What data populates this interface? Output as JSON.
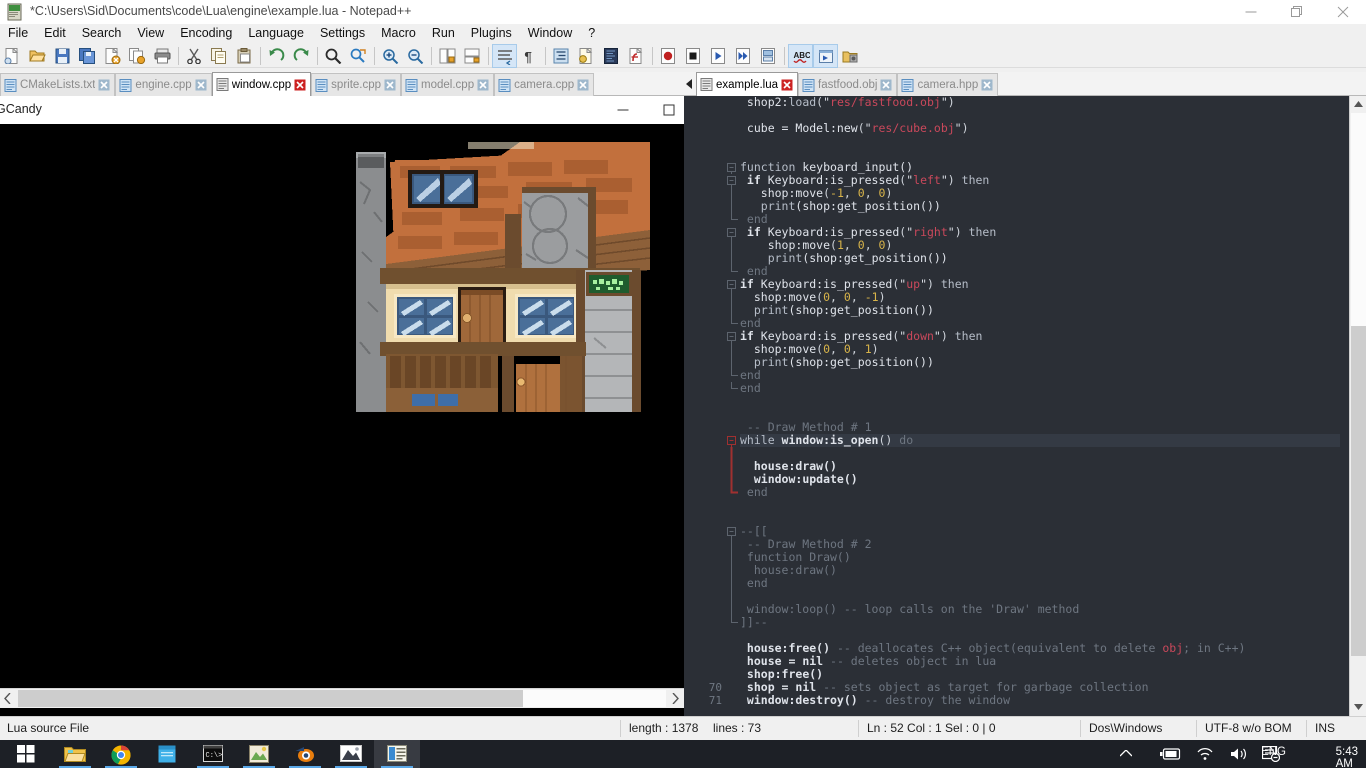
{
  "npp": {
    "title": "*C:\\Users\\Sid\\Documents\\code\\Lua\\engine\\example.lua - Notepad++",
    "app_icon": "notepadpp-icon",
    "window_controls": {
      "minimize": "minimize-icon",
      "maximize": "maximize-icon",
      "close": "close-icon"
    },
    "menu": [
      "File",
      "Edit",
      "Search",
      "View",
      "Encoding",
      "Language",
      "Settings",
      "Macro",
      "Run",
      "Plugins",
      "Window",
      "?"
    ],
    "toolbar": [
      {
        "name": "new-file",
        "sep": false
      },
      {
        "name": "open-file",
        "sep": false
      },
      {
        "name": "save-file",
        "sep": false
      },
      {
        "name": "save-all",
        "sep": false
      },
      {
        "name": "close-file",
        "sep": false
      },
      {
        "name": "close-all",
        "sep": false
      },
      {
        "name": "print",
        "sep": true
      },
      {
        "name": "cut",
        "sep": false
      },
      {
        "name": "copy",
        "sep": false
      },
      {
        "name": "paste",
        "sep": true
      },
      {
        "name": "undo",
        "sep": false
      },
      {
        "name": "redo",
        "sep": true
      },
      {
        "name": "find",
        "sep": false
      },
      {
        "name": "replace",
        "sep": true
      },
      {
        "name": "zoom-in",
        "sep": false
      },
      {
        "name": "zoom-out",
        "sep": true
      },
      {
        "name": "sync-vertical-scroll",
        "sep": false
      },
      {
        "name": "sync-horizontal-scroll",
        "sep": true
      },
      {
        "name": "word-wrap",
        "sep": false
      },
      {
        "name": "show-all-characters",
        "sep": true
      },
      {
        "name": "indent-guide",
        "sep": false
      },
      {
        "name": "user-defined-dialog",
        "sep": false
      },
      {
        "name": "document-map",
        "sep": false
      },
      {
        "name": "function-list",
        "sep": true
      },
      {
        "name": "start-record-macro",
        "sep": false
      },
      {
        "name": "stop-record-macro",
        "sep": false
      },
      {
        "name": "play-macro",
        "sep": false
      },
      {
        "name": "run-macro-multiple",
        "sep": false
      },
      {
        "name": "save-macro",
        "sep": true
      },
      {
        "name": "spell-check",
        "sep": false
      },
      {
        "name": "run",
        "sep": false
      },
      {
        "name": "open-folder-explorer",
        "sep": false
      }
    ],
    "tabs_left": [
      {
        "label": "CMakeLists.txt",
        "active": false
      },
      {
        "label": "engine.cpp",
        "active": false
      },
      {
        "label": "window.cpp",
        "active": true
      },
      {
        "label": "sprite.cpp",
        "active": false
      },
      {
        "label": "model.cpp",
        "active": false
      },
      {
        "label": "camera.cpp",
        "active": false
      }
    ],
    "tabs_right": [
      {
        "label": "example.lua",
        "active": true
      },
      {
        "label": "fastfood.obj",
        "active": false
      },
      {
        "label": "camera.hpp",
        "active": false
      }
    ],
    "status": {
      "doc_type": "Lua source File",
      "length_label": "length : 1378",
      "lines_label": "lines : 73",
      "caret": "Ln : 52   Col : 1   Sel : 0 | 0",
      "eol": "Dos\\Windows",
      "encoding": "UTF-8 w/o BOM",
      "insert_mode": "INS"
    },
    "gutter_line_numbers": [
      "70",
      "71"
    ]
  },
  "editor": {
    "first_visible_line": 18,
    "code_lines": [
      {
        "fold": "",
        "cur": false,
        "tokens": [
          {
            "t": " shop2:",
            "c": "id"
          },
          {
            "t": "load",
            "c": "fn"
          },
          {
            "t": "(",
            "c": "pn"
          },
          {
            "t": "\"",
            "c": "strq"
          },
          {
            "t": "res/fastfood.obj",
            "c": "str"
          },
          {
            "t": "\"",
            "c": "strq"
          },
          {
            "t": ")",
            "c": "pn"
          }
        ]
      },
      {
        "fold": "",
        "cur": false,
        "tokens": []
      },
      {
        "fold": "",
        "cur": false,
        "tokens": [
          {
            "t": " cube = ",
            "c": "id"
          },
          {
            "t": "Model:new",
            "c": "id"
          },
          {
            "t": "(",
            "c": "pn"
          },
          {
            "t": "\"",
            "c": "strq"
          },
          {
            "t": "res/cube.obj",
            "c": "str"
          },
          {
            "t": "\"",
            "c": "strq"
          },
          {
            "t": ")",
            "c": "pn"
          }
        ]
      },
      {
        "fold": "",
        "cur": false,
        "tokens": []
      },
      {
        "fold": "",
        "cur": false,
        "tokens": []
      },
      {
        "fold": "open",
        "cur": false,
        "tokens": [
          {
            "t": "function ",
            "c": "kw2"
          },
          {
            "t": "keyboard_input()",
            "c": "id"
          }
        ]
      },
      {
        "fold": "open",
        "cur": false,
        "tokens": [
          {
            "t": " if ",
            "c": "kw"
          },
          {
            "t": "Keyboard:is_pressed",
            "c": "id"
          },
          {
            "t": "(",
            "c": "pn"
          },
          {
            "t": "\"",
            "c": "strq"
          },
          {
            "t": "left",
            "c": "str"
          },
          {
            "t": "\"",
            "c": "strq"
          },
          {
            "t": ") ",
            "c": "pn"
          },
          {
            "t": "then",
            "c": "kw2"
          }
        ]
      },
      {
        "fold": "bar",
        "cur": false,
        "tokens": [
          {
            "t": "   shop:",
            "c": "id"
          },
          {
            "t": "move",
            "c": "id"
          },
          {
            "t": "(",
            "c": "pn"
          },
          {
            "t": "-1",
            "c": "num"
          },
          {
            "t": ", ",
            "c": "pn"
          },
          {
            "t": "0",
            "c": "num"
          },
          {
            "t": ", ",
            "c": "pn"
          },
          {
            "t": "0",
            "c": "num"
          },
          {
            "t": ")",
            "c": "pn"
          }
        ]
      },
      {
        "fold": "bar",
        "cur": false,
        "tokens": [
          {
            "t": "   ",
            "c": "id"
          },
          {
            "t": "print",
            "c": "fn"
          },
          {
            "t": "(shop:get_position())",
            "c": "id"
          }
        ]
      },
      {
        "fold": "end",
        "cur": false,
        "tokens": [
          {
            "t": " end",
            "c": "cmt"
          }
        ]
      },
      {
        "fold": "open",
        "cur": false,
        "tokens": [
          {
            "t": " if ",
            "c": "kw"
          },
          {
            "t": "Keyboard:is_pressed",
            "c": "id"
          },
          {
            "t": "(",
            "c": "pn"
          },
          {
            "t": "\"",
            "c": "strq"
          },
          {
            "t": "right",
            "c": "str"
          },
          {
            "t": "\"",
            "c": "strq"
          },
          {
            "t": ") ",
            "c": "pn"
          },
          {
            "t": "then",
            "c": "kw2"
          }
        ]
      },
      {
        "fold": "bar",
        "cur": false,
        "tokens": [
          {
            "t": "    shop:",
            "c": "id"
          },
          {
            "t": "move",
            "c": "id"
          },
          {
            "t": "(",
            "c": "pn"
          },
          {
            "t": "1",
            "c": "num"
          },
          {
            "t": ", ",
            "c": "pn"
          },
          {
            "t": "0",
            "c": "num"
          },
          {
            "t": ", ",
            "c": "pn"
          },
          {
            "t": "0",
            "c": "num"
          },
          {
            "t": ")",
            "c": "pn"
          }
        ]
      },
      {
        "fold": "bar",
        "cur": false,
        "tokens": [
          {
            "t": "    ",
            "c": "id"
          },
          {
            "t": "print",
            "c": "fn"
          },
          {
            "t": "(shop:get_position())",
            "c": "id"
          }
        ]
      },
      {
        "fold": "end",
        "cur": false,
        "tokens": [
          {
            "t": " end",
            "c": "cmt"
          }
        ]
      },
      {
        "fold": "open",
        "cur": false,
        "tokens": [
          {
            "t": "if ",
            "c": "kw"
          },
          {
            "t": "Keyboard:is_pressed",
            "c": "id"
          },
          {
            "t": "(",
            "c": "pn"
          },
          {
            "t": "\"",
            "c": "strq"
          },
          {
            "t": "up",
            "c": "str"
          },
          {
            "t": "\"",
            "c": "strq"
          },
          {
            "t": ") ",
            "c": "pn"
          },
          {
            "t": "then",
            "c": "kw2"
          }
        ]
      },
      {
        "fold": "bar",
        "cur": false,
        "tokens": [
          {
            "t": "  shop:",
            "c": "id"
          },
          {
            "t": "move",
            "c": "id"
          },
          {
            "t": "(",
            "c": "pn"
          },
          {
            "t": "0",
            "c": "num"
          },
          {
            "t": ", ",
            "c": "pn"
          },
          {
            "t": "0",
            "c": "num"
          },
          {
            "t": ", ",
            "c": "pn"
          },
          {
            "t": "-1",
            "c": "num"
          },
          {
            "t": ")",
            "c": "pn"
          }
        ]
      },
      {
        "fold": "bar",
        "cur": false,
        "tokens": [
          {
            "t": "  ",
            "c": "id"
          },
          {
            "t": "print",
            "c": "fn"
          },
          {
            "t": "(shop:get_position())",
            "c": "id"
          }
        ]
      },
      {
        "fold": "end",
        "cur": false,
        "tokens": [
          {
            "t": "end",
            "c": "cmt"
          }
        ]
      },
      {
        "fold": "open",
        "cur": false,
        "tokens": [
          {
            "t": "if ",
            "c": "kw"
          },
          {
            "t": "Keyboard:is_pressed",
            "c": "id"
          },
          {
            "t": "(",
            "c": "pn"
          },
          {
            "t": "\"",
            "c": "strq"
          },
          {
            "t": "down",
            "c": "str"
          },
          {
            "t": "\"",
            "c": "strq"
          },
          {
            "t": ") ",
            "c": "pn"
          },
          {
            "t": "then",
            "c": "kw2"
          }
        ]
      },
      {
        "fold": "bar",
        "cur": false,
        "tokens": [
          {
            "t": "  shop:",
            "c": "id"
          },
          {
            "t": "move",
            "c": "id"
          },
          {
            "t": "(",
            "c": "pn"
          },
          {
            "t": "0",
            "c": "num"
          },
          {
            "t": ", ",
            "c": "pn"
          },
          {
            "t": "0",
            "c": "num"
          },
          {
            "t": ", ",
            "c": "pn"
          },
          {
            "t": "1",
            "c": "num"
          },
          {
            "t": ")",
            "c": "pn"
          }
        ]
      },
      {
        "fold": "bar",
        "cur": false,
        "tokens": [
          {
            "t": "  ",
            "c": "id"
          },
          {
            "t": "print",
            "c": "fn"
          },
          {
            "t": "(shop:get_position())",
            "c": "id"
          }
        ]
      },
      {
        "fold": "end",
        "cur": false,
        "tokens": [
          {
            "t": "end",
            "c": "cmt"
          }
        ]
      },
      {
        "fold": "end",
        "cur": false,
        "tokens": [
          {
            "t": "end",
            "c": "cmt"
          }
        ]
      },
      {
        "fold": "",
        "cur": false,
        "tokens": []
      },
      {
        "fold": "",
        "cur": false,
        "tokens": []
      },
      {
        "fold": "",
        "cur": false,
        "tokens": [
          {
            "t": " -- Draw Method # 1",
            "c": "cmt"
          }
        ]
      },
      {
        "fold": "openred",
        "cur": true,
        "tokens": [
          {
            "t": "while ",
            "c": "kw2"
          },
          {
            "t": "window:is_open",
            "c": "kw"
          },
          {
            "t": "() ",
            "c": "pn"
          },
          {
            "t": "do",
            "c": "cmt"
          }
        ]
      },
      {
        "fold": "barred",
        "cur": false,
        "tokens": []
      },
      {
        "fold": "barred",
        "cur": false,
        "tokens": [
          {
            "t": "  house:",
            "c": "kw"
          },
          {
            "t": "draw()",
            "c": "kw"
          }
        ]
      },
      {
        "fold": "barred",
        "cur": false,
        "tokens": [
          {
            "t": "  window:",
            "c": "kw"
          },
          {
            "t": "update()",
            "c": "kw"
          }
        ]
      },
      {
        "fold": "endred",
        "cur": false,
        "tokens": [
          {
            "t": " end",
            "c": "cmt"
          }
        ]
      },
      {
        "fold": "",
        "cur": false,
        "tokens": []
      },
      {
        "fold": "",
        "cur": false,
        "tokens": []
      },
      {
        "fold": "open",
        "cur": false,
        "tokens": [
          {
            "t": "--[[",
            "c": "cmt"
          }
        ]
      },
      {
        "fold": "bar",
        "cur": false,
        "tokens": [
          {
            "t": " -- Draw Method # 2",
            "c": "cmt"
          }
        ]
      },
      {
        "fold": "bar",
        "cur": false,
        "tokens": [
          {
            "t": " function Draw()",
            "c": "cmt"
          }
        ]
      },
      {
        "fold": "bar",
        "cur": false,
        "tokens": [
          {
            "t": "  house:draw()",
            "c": "cmt"
          }
        ]
      },
      {
        "fold": "bar",
        "cur": false,
        "tokens": [
          {
            "t": " end",
            "c": "cmt"
          }
        ]
      },
      {
        "fold": "bar",
        "cur": false,
        "tokens": []
      },
      {
        "fold": "bar",
        "cur": false,
        "tokens": [
          {
            "t": " window:loop() -- loop calls on the 'Draw' method",
            "c": "cmt"
          }
        ]
      },
      {
        "fold": "end",
        "cur": false,
        "tokens": [
          {
            "t": "]]--",
            "c": "cmt"
          }
        ]
      },
      {
        "fold": "",
        "cur": false,
        "tokens": []
      },
      {
        "fold": "",
        "cur": false,
        "tokens": [
          {
            "t": " house:",
            "c": "kw"
          },
          {
            "t": "free()",
            "c": "kw"
          },
          {
            "t": " -- deallocates C++ object(equivalent to delete ",
            "c": "cmt"
          },
          {
            "t": "obj",
            "c": "str"
          },
          {
            "t": "; in C++)",
            "c": "cmt"
          }
        ]
      },
      {
        "fold": "",
        "cur": false,
        "tokens": [
          {
            "t": " house = ",
            "c": "kw"
          },
          {
            "t": "nil",
            "c": "kw"
          },
          {
            "t": " -- deletes object in lua",
            "c": "cmt"
          }
        ]
      },
      {
        "fold": "",
        "cur": false,
        "tokens": [
          {
            "t": " shop:",
            "c": "kw"
          },
          {
            "t": "free()",
            "c": "kw"
          }
        ]
      },
      {
        "fold": "",
        "cur": false,
        "tokens": [
          {
            "t": " shop = ",
            "c": "kw"
          },
          {
            "t": "nil",
            "c": "kw"
          },
          {
            "t": " -- sets object as target for garbage collection",
            "c": "cmt"
          }
        ]
      },
      {
        "fold": "",
        "cur": false,
        "tokens": [
          {
            "t": " window:",
            "c": "kw"
          },
          {
            "t": "destroy()",
            "c": "kw"
          },
          {
            "t": " -- destroy the window",
            "c": "cmt"
          }
        ]
      }
    ]
  },
  "game": {
    "title": "GCandy",
    "window_controls": {
      "minimize": "minimize-icon",
      "maximize": "maximize-icon",
      "close": "close-icon"
    },
    "scene": "pixel-art-house-3d-model",
    "background_color": "#000000"
  },
  "taskbar": {
    "start": "windows-start-icon",
    "apps": [
      {
        "name": "file-explorer-icon",
        "running": true,
        "selected": false
      },
      {
        "name": "google-chrome-icon",
        "running": true,
        "selected": false
      },
      {
        "name": "sticky-notes-icon",
        "running": false,
        "selected": false
      },
      {
        "name": "command-prompt-icon",
        "running": true,
        "selected": false
      },
      {
        "name": "gimp-icon",
        "running": true,
        "selected": false
      },
      {
        "name": "blender-icon",
        "running": true,
        "selected": false
      },
      {
        "name": "photos-icon",
        "running": true,
        "selected": false
      },
      {
        "name": "notepad-plus-plus-icon",
        "running": true,
        "selected": true
      }
    ],
    "tray": {
      "show_hidden": "chevron-up-icon",
      "battery": "battery-charging-icon",
      "network": "wifi-icon",
      "volume": "speaker-icon",
      "action_center": "action-center-icon",
      "language": "ENG",
      "clock": "5:43 AM"
    }
  },
  "colors": {
    "editor_bg": "#2b2f36",
    "editor_current_line": "#343a44",
    "string_red": "#c9485b",
    "comment_grey": "#6e7681",
    "number_gold": "#d8b44a",
    "taskbar": "#1d2026",
    "chrome": "#f0f0f0"
  }
}
